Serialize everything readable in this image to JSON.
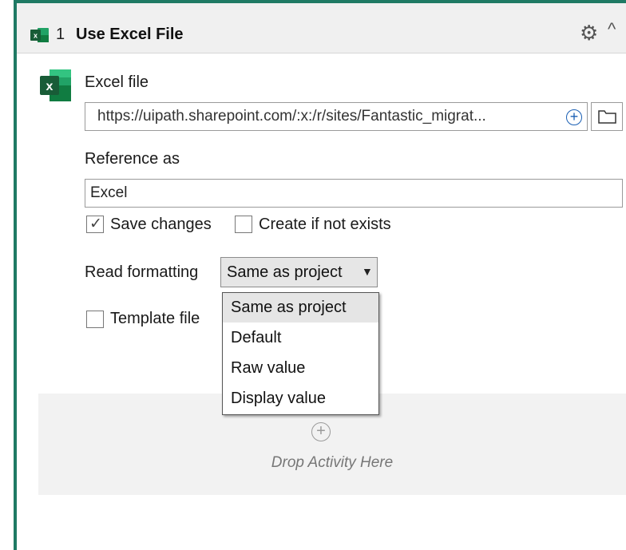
{
  "header": {
    "index": "1",
    "title": "Use Excel File",
    "icon": "excel-icon"
  },
  "excel_file": {
    "label": "Excel file",
    "value": "https://uipath.sharepoint.com/:x:/r/sites/Fantastic_migrat..."
  },
  "reference": {
    "label": "Reference as",
    "value": "Excel"
  },
  "options": {
    "save_changes": {
      "label": "Save changes",
      "checked": true
    },
    "create_if_not_exists": {
      "label": "Create if not exists",
      "checked": false
    },
    "template_file": {
      "label": "Template file",
      "checked": false
    }
  },
  "read_formatting": {
    "label": "Read formatting",
    "selected": "Same as project",
    "items": [
      "Same as project",
      "Default",
      "Raw value",
      "Display value"
    ]
  },
  "drop_zone": {
    "text": "Drop Activity Here"
  },
  "colors": {
    "accent": "#1f7a64",
    "excel_green": "#107c41",
    "link_blue": "#1a5fb4"
  }
}
